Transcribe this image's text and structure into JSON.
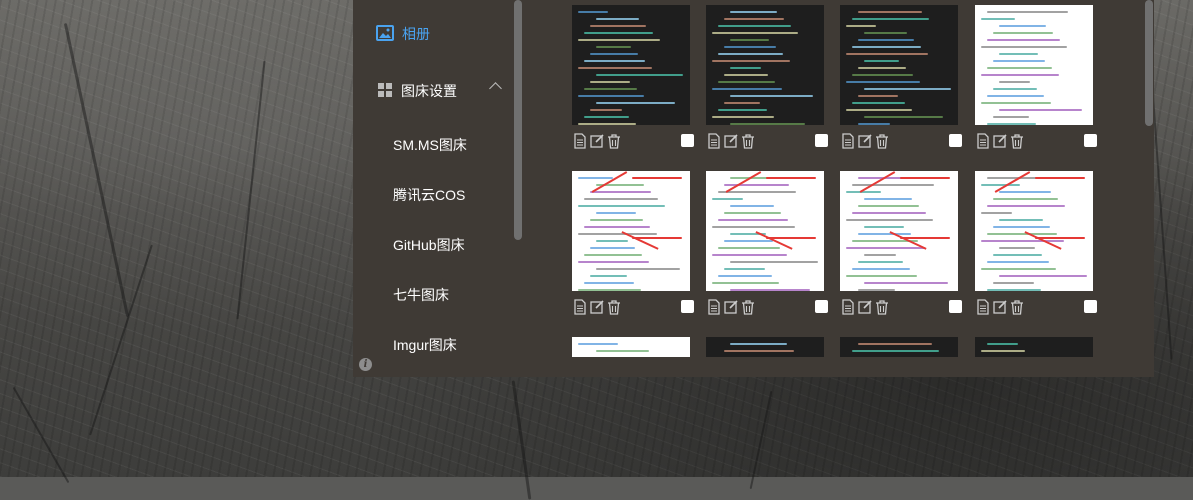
{
  "sidebar": {
    "album_label": "相册",
    "settings_label": "图床设置",
    "hosts": [
      "SM.MS图床",
      "腾讯云COS",
      "GitHub图床",
      "七牛图床",
      "Imgur图床"
    ]
  },
  "gallery": {
    "rows": 3,
    "columns": 4
  },
  "colors": {
    "window_bg": "#3f3a35",
    "accent": "#4aa3f0"
  }
}
